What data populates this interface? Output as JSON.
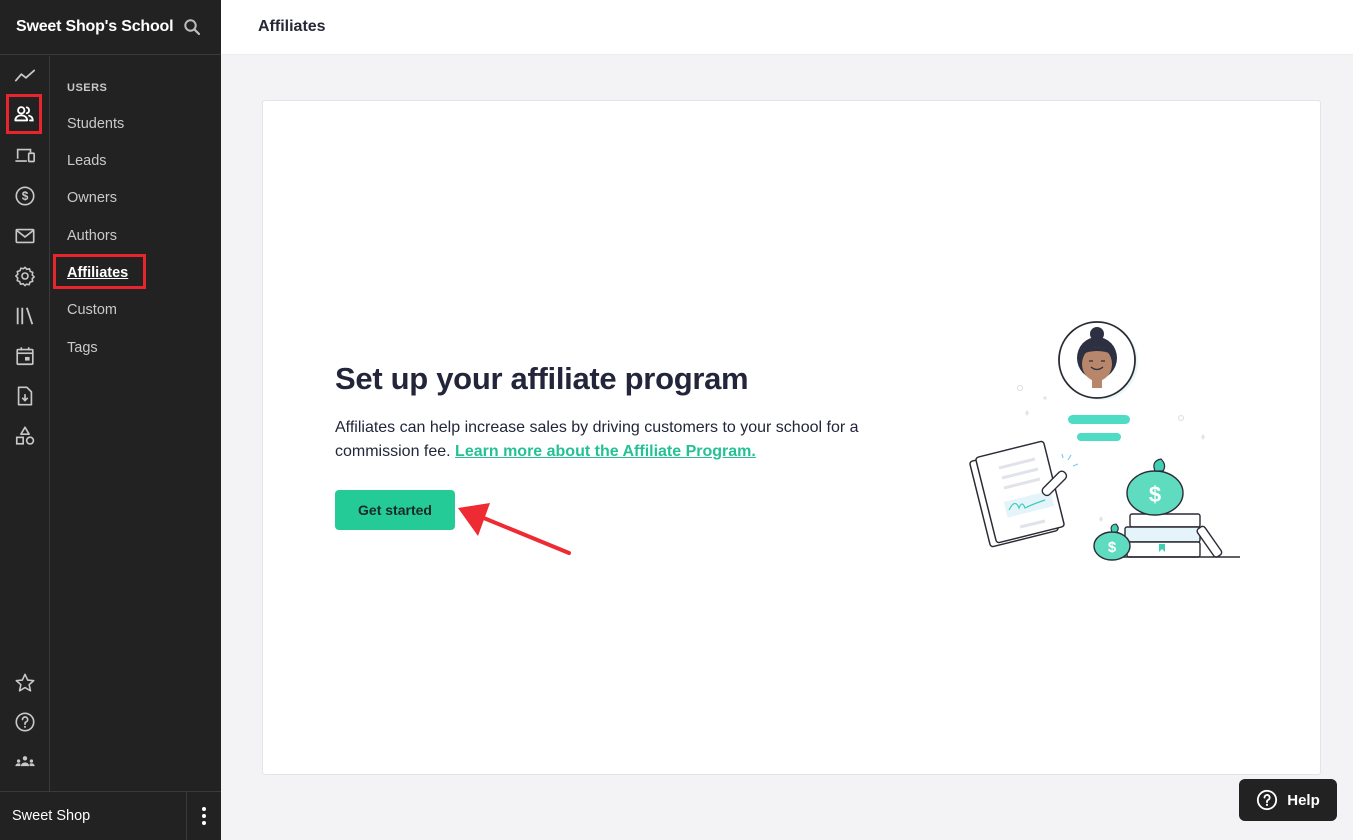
{
  "sidebar": {
    "school_name": "Sweet Shop's School",
    "icons": [
      {
        "name": "analytics-icon",
        "active": false
      },
      {
        "name": "users-icon",
        "active": true
      },
      {
        "name": "devices-icon",
        "active": false
      },
      {
        "name": "dollar-icon",
        "active": false
      },
      {
        "name": "mail-icon",
        "active": false
      },
      {
        "name": "gear-icon",
        "active": false
      },
      {
        "name": "library-icon",
        "active": false
      },
      {
        "name": "calendar-icon",
        "active": false
      },
      {
        "name": "file-download-icon",
        "active": false
      },
      {
        "name": "shapes-icon",
        "active": false
      },
      {
        "name": "star-icon",
        "active": false
      },
      {
        "name": "help-circle-icon",
        "active": false
      },
      {
        "name": "community-icon",
        "active": false
      }
    ],
    "submenu": {
      "title": "USERS",
      "items": [
        {
          "label": "Students",
          "active": false
        },
        {
          "label": "Leads",
          "active": false
        },
        {
          "label": "Owners",
          "active": false
        },
        {
          "label": "Authors",
          "active": false
        },
        {
          "label": "Affiliates",
          "active": true
        },
        {
          "label": "Custom",
          "active": false
        },
        {
          "label": "Tags",
          "active": false
        }
      ]
    },
    "footer": {
      "name": "Sweet Shop"
    }
  },
  "header": {
    "title": "Affiliates"
  },
  "main": {
    "headline": "Set up your affiliate program",
    "description": "Affiliates can help increase sales by driving customers to your school for a commission fee.",
    "link_label": "Learn more about the Affiliate Program.",
    "cta_label": "Get started"
  },
  "help": {
    "label": "Help"
  },
  "colors": {
    "accent": "#25cb97",
    "sidebar_bg": "#222222",
    "highlight": "#e8242c"
  }
}
